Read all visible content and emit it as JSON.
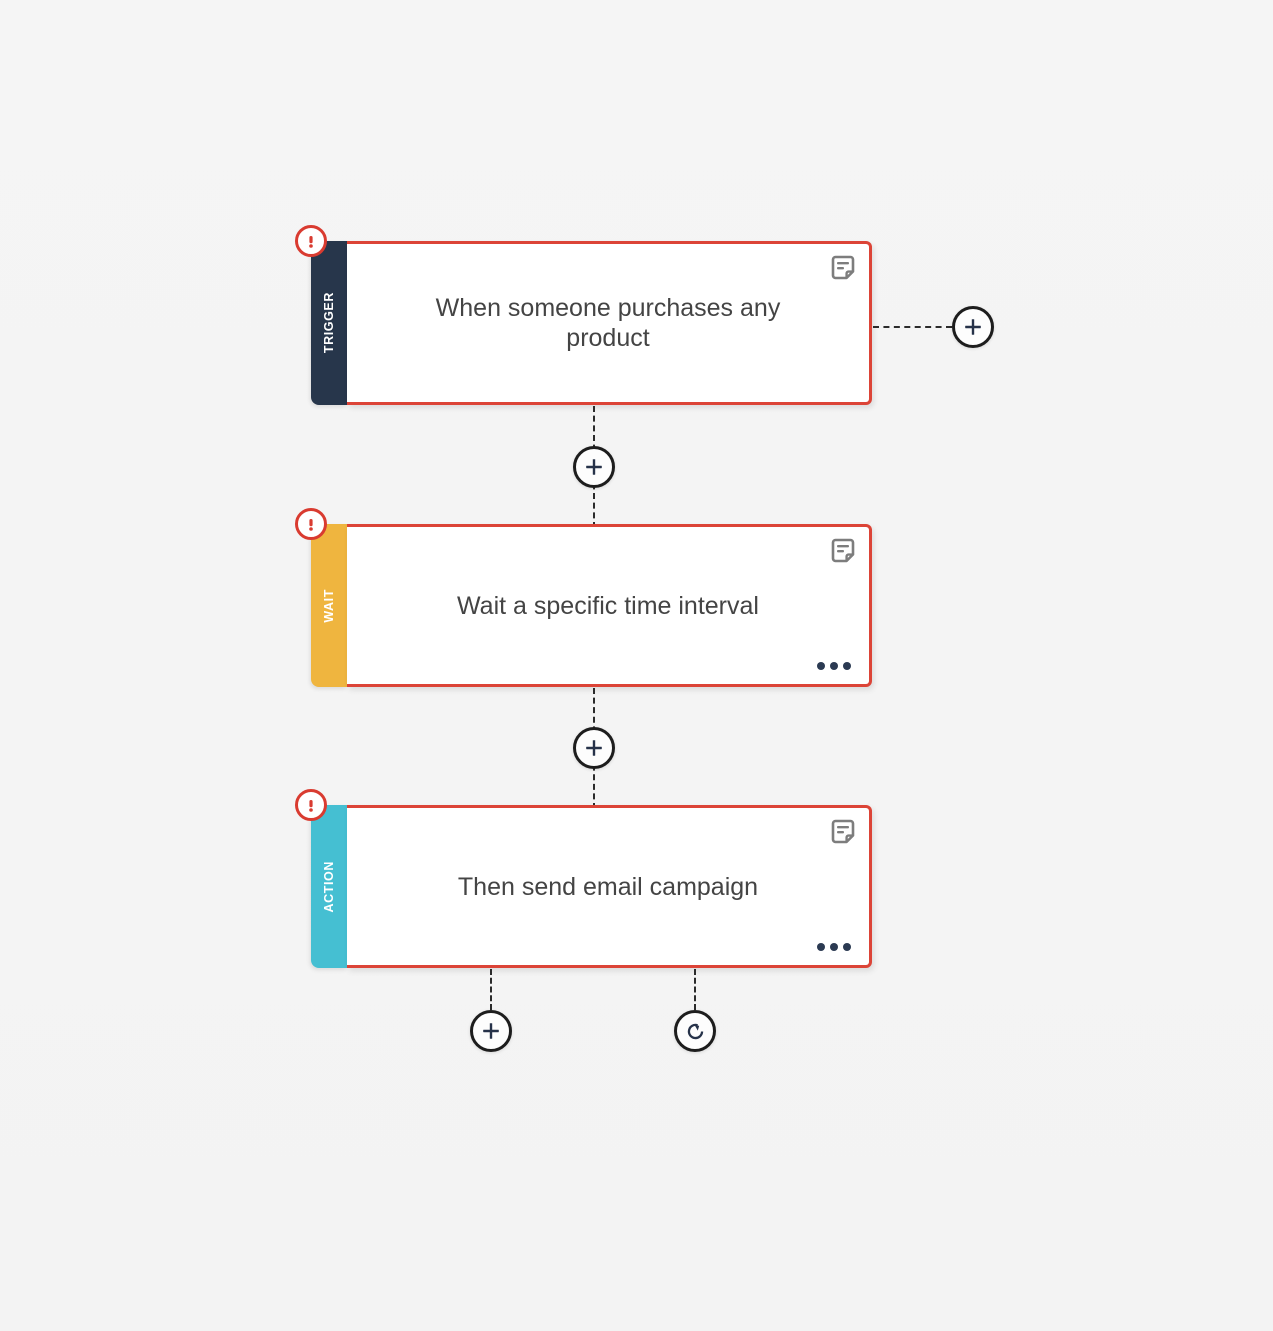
{
  "canvas": {
    "background_color": "#f4f4f4",
    "accent_error_color": "#dc4437",
    "badge_color": "#d93b30",
    "connector_color": "#2b2b2b",
    "title_text_color": "#444444"
  },
  "nodes": [
    {
      "id": "trigger",
      "rail_label": "TRIGGER",
      "rail_color": "#27364b",
      "title": "When someone purchases any product",
      "alert_badge": "alert-exclamation-icon",
      "note_icon": "note-icon",
      "has_ellipsis": false
    },
    {
      "id": "wait",
      "rail_label": "WAIT",
      "rail_color": "#efb53f",
      "title": "Wait a specific time interval",
      "alert_badge": "alert-exclamation-icon",
      "note_icon": "note-icon",
      "has_ellipsis": true
    },
    {
      "id": "action",
      "rail_label": "ACTION",
      "rail_color": "#45bfd2",
      "title": "Then send email campaign",
      "alert_badge": "alert-exclamation-icon",
      "note_icon": "note-icon",
      "has_ellipsis": true
    }
  ],
  "connectors": {
    "trigger_branch_right": {
      "icon": "plus-icon",
      "label": "+"
    },
    "trigger_to_wait": {
      "icon": "plus-icon",
      "label": "+"
    },
    "wait_to_action": {
      "icon": "plus-icon",
      "label": "+"
    },
    "action_branch_add": {
      "icon": "plus-icon",
      "label": "+"
    },
    "action_branch_repeat": {
      "icon": "refresh-icon",
      "label": ""
    }
  },
  "ellipsis_menu": {
    "dots": "•••",
    "name": "more-options"
  }
}
